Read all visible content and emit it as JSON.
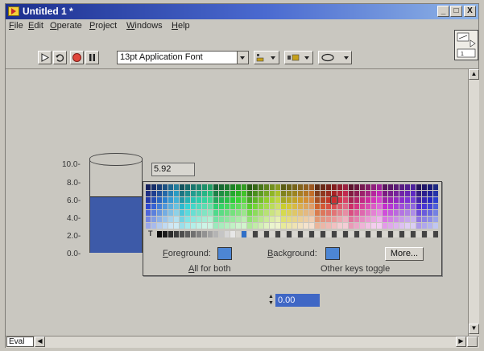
{
  "window": {
    "title": "Untitled 1 *",
    "buttons": [
      "_",
      "□",
      "X"
    ]
  },
  "menu": [
    {
      "label": "File",
      "u": "F",
      "rest": "ile"
    },
    {
      "label": "Edit",
      "u": "E",
      "rest": "dit"
    },
    {
      "label": "Operate",
      "u": "O",
      "rest": "perate"
    },
    {
      "label": "Project",
      "u": "P",
      "rest": "roject"
    },
    {
      "label": "Windows",
      "u": "W",
      "rest": "indows"
    },
    {
      "label": "Help",
      "u": "H",
      "rest": "elp"
    }
  ],
  "toolbar": {
    "font": "13pt Application Font",
    "buttons": [
      "run-arrow-icon",
      "run-continuously-icon",
      "abort-icon",
      "pause-icon"
    ],
    "tools": [
      "align-icon",
      "distribute-icon",
      "reorder-icon"
    ]
  },
  "tank": {
    "scale": [
      "10.0-",
      "8.0-",
      "6.0-",
      "4.0-",
      "2.0-",
      "0.0-"
    ],
    "max": 10.0,
    "min": 0.0,
    "level": 5.92,
    "fill_color": "#3d5aa8"
  },
  "digital_display": "5.92",
  "color_picker": {
    "t_label": "T",
    "foreground_u": "F",
    "foreground_rest": "oreground:",
    "background_u": "B",
    "background_rest": "ackground:",
    "more": "More...",
    "all_u": "A",
    "all_rest": "ll for both",
    "other_keys": "Other keys toggle",
    "sample_color": "#4d86d4"
  },
  "numeric_control": {
    "value": "0.00"
  },
  "status": {
    "eval": "Eval"
  }
}
